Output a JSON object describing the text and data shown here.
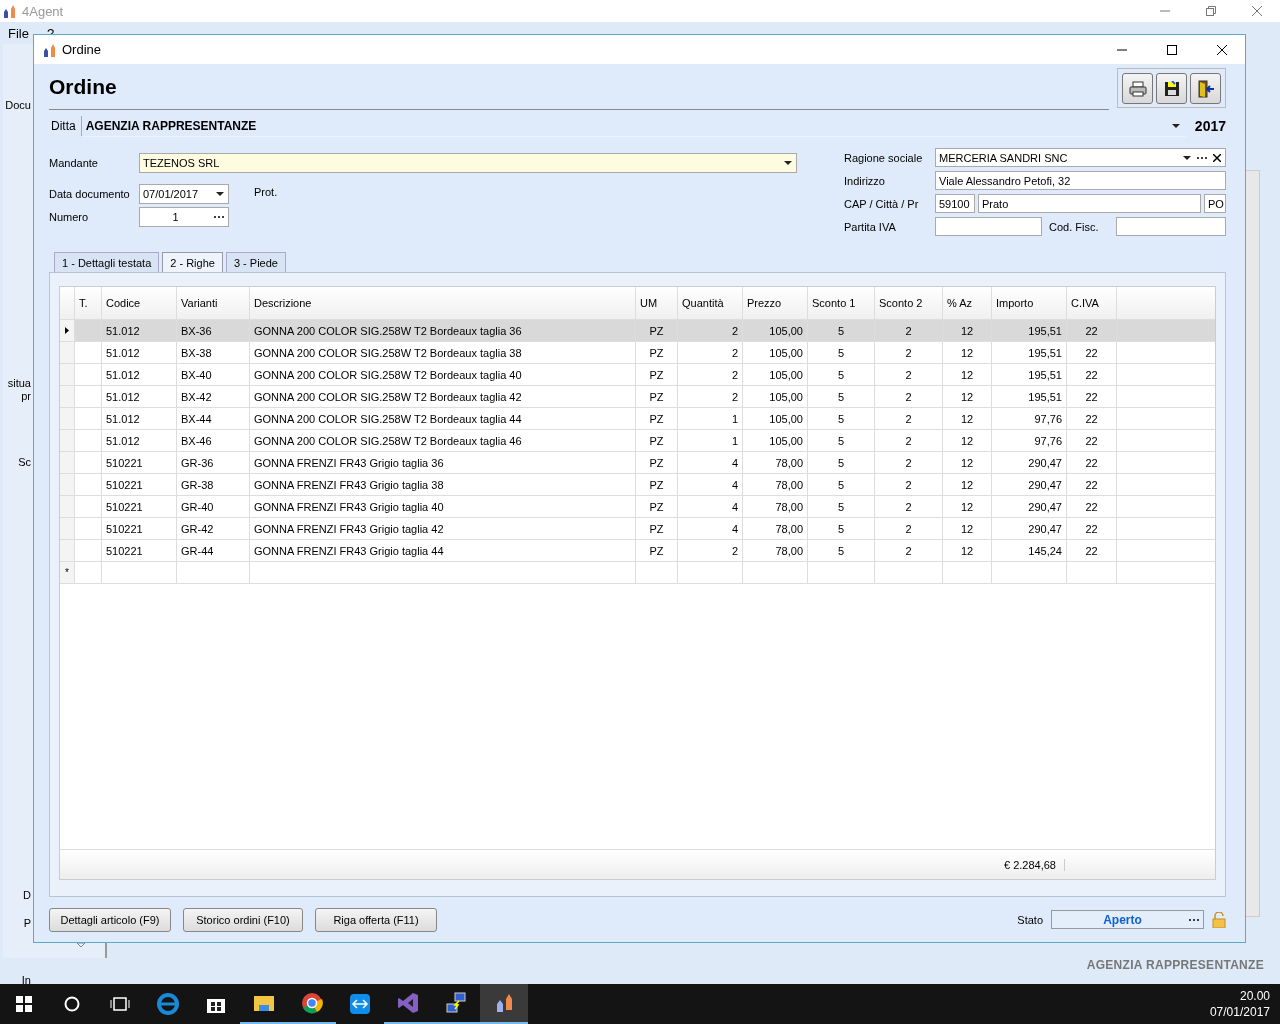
{
  "app": {
    "title": "4Agent",
    "menu": [
      "File",
      "?"
    ],
    "sidebar_fragments": [
      "Docu",
      "situa",
      "pr",
      "Sc",
      "D",
      "P",
      "In"
    ],
    "status_company": "AGENZIA RAPPRESENTANZE"
  },
  "dialog": {
    "title": "Ordine",
    "heading": "Ordine",
    "ditta": {
      "label": "Ditta",
      "value": "AGENZIA RAPPRESENTANZE",
      "year": "2017"
    },
    "form": {
      "mandante": {
        "label": "Mandante",
        "value": "TEZENOS SRL"
      },
      "data_documento": {
        "label": "Data documento",
        "value": "07/01/2017"
      },
      "prot": {
        "label": "Prot."
      },
      "numero": {
        "label": "Numero",
        "value": "1"
      },
      "ragione_sociale": {
        "label": "Ragione sociale",
        "value": "MERCERIA SANDRI SNC"
      },
      "indirizzo": {
        "label": "Indirizzo",
        "value": "Viale Alessandro Petofi, 32"
      },
      "cap_citta_pr": {
        "label": "CAP / Città / Pr",
        "cap": "59100",
        "citta": "Prato",
        "pr": "PO"
      },
      "partita_iva": {
        "label": "Partita IVA"
      },
      "cod_fisc": {
        "label": "Cod. Fisc."
      }
    },
    "tabs": [
      {
        "label": "1 - Dettagli testata",
        "selected": false
      },
      {
        "label": "2 - Righe",
        "selected": true
      },
      {
        "label": "3 - Piede",
        "selected": false
      }
    ],
    "table": {
      "columns": [
        "T.",
        "Codice",
        "Varianti",
        "Descrizione",
        "UM",
        "Quantità",
        "Prezzo",
        "Sconto 1",
        "Sconto 2",
        "% Az",
        "Importo",
        "C.IVA"
      ],
      "rows": [
        {
          "selected": true,
          "cells": [
            "",
            "51.012",
            "BX-36",
            "GONNA 200 COLOR SIG.258W T2 Bordeaux taglia 36",
            "PZ",
            "2",
            "105,00",
            "5",
            "2",
            "12",
            "195,51",
            "22"
          ]
        },
        {
          "selected": false,
          "cells": [
            "",
            "51.012",
            "BX-38",
            "GONNA 200 COLOR SIG.258W T2 Bordeaux taglia 38",
            "PZ",
            "2",
            "105,00",
            "5",
            "2",
            "12",
            "195,51",
            "22"
          ]
        },
        {
          "selected": false,
          "cells": [
            "",
            "51.012",
            "BX-40",
            "GONNA 200 COLOR SIG.258W T2 Bordeaux taglia 40",
            "PZ",
            "2",
            "105,00",
            "5",
            "2",
            "12",
            "195,51",
            "22"
          ]
        },
        {
          "selected": false,
          "cells": [
            "",
            "51.012",
            "BX-42",
            "GONNA 200 COLOR SIG.258W T2 Bordeaux taglia 42",
            "PZ",
            "2",
            "105,00",
            "5",
            "2",
            "12",
            "195,51",
            "22"
          ]
        },
        {
          "selected": false,
          "cells": [
            "",
            "51.012",
            "BX-44",
            "GONNA 200 COLOR SIG.258W T2 Bordeaux taglia 44",
            "PZ",
            "1",
            "105,00",
            "5",
            "2",
            "12",
            "97,76",
            "22"
          ]
        },
        {
          "selected": false,
          "cells": [
            "",
            "51.012",
            "BX-46",
            "GONNA 200 COLOR SIG.258W T2 Bordeaux taglia 46",
            "PZ",
            "1",
            "105,00",
            "5",
            "2",
            "12",
            "97,76",
            "22"
          ]
        },
        {
          "selected": false,
          "cells": [
            "",
            "510221",
            "GR-36",
            "GONNA FRENZI FR43 Grigio taglia 36",
            "PZ",
            "4",
            "78,00",
            "5",
            "2",
            "12",
            "290,47",
            "22"
          ]
        },
        {
          "selected": false,
          "cells": [
            "",
            "510221",
            "GR-38",
            "GONNA FRENZI FR43 Grigio taglia 38",
            "PZ",
            "4",
            "78,00",
            "5",
            "2",
            "12",
            "290,47",
            "22"
          ]
        },
        {
          "selected": false,
          "cells": [
            "",
            "510221",
            "GR-40",
            "GONNA FRENZI FR43 Grigio taglia 40",
            "PZ",
            "4",
            "78,00",
            "5",
            "2",
            "12",
            "290,47",
            "22"
          ]
        },
        {
          "selected": false,
          "cells": [
            "",
            "510221",
            "GR-42",
            "GONNA FRENZI FR43 Grigio taglia 42",
            "PZ",
            "4",
            "78,00",
            "5",
            "2",
            "12",
            "290,47",
            "22"
          ]
        },
        {
          "selected": false,
          "cells": [
            "",
            "510221",
            "GR-44",
            "GONNA FRENZI FR43 Grigio taglia 44",
            "PZ",
            "2",
            "78,00",
            "5",
            "2",
            "12",
            "145,24",
            "22"
          ]
        }
      ],
      "new_row_marker": "*",
      "total": "€ 2.284,68"
    },
    "buttons": [
      "Dettagli articolo (F9)",
      "Storico ordini (F10)",
      "Riga offerta (F11)"
    ],
    "stato": {
      "label": "Stato",
      "value": "Aperto"
    }
  },
  "taskbar": {
    "time": "20.00",
    "date": "07/01/2017"
  }
}
